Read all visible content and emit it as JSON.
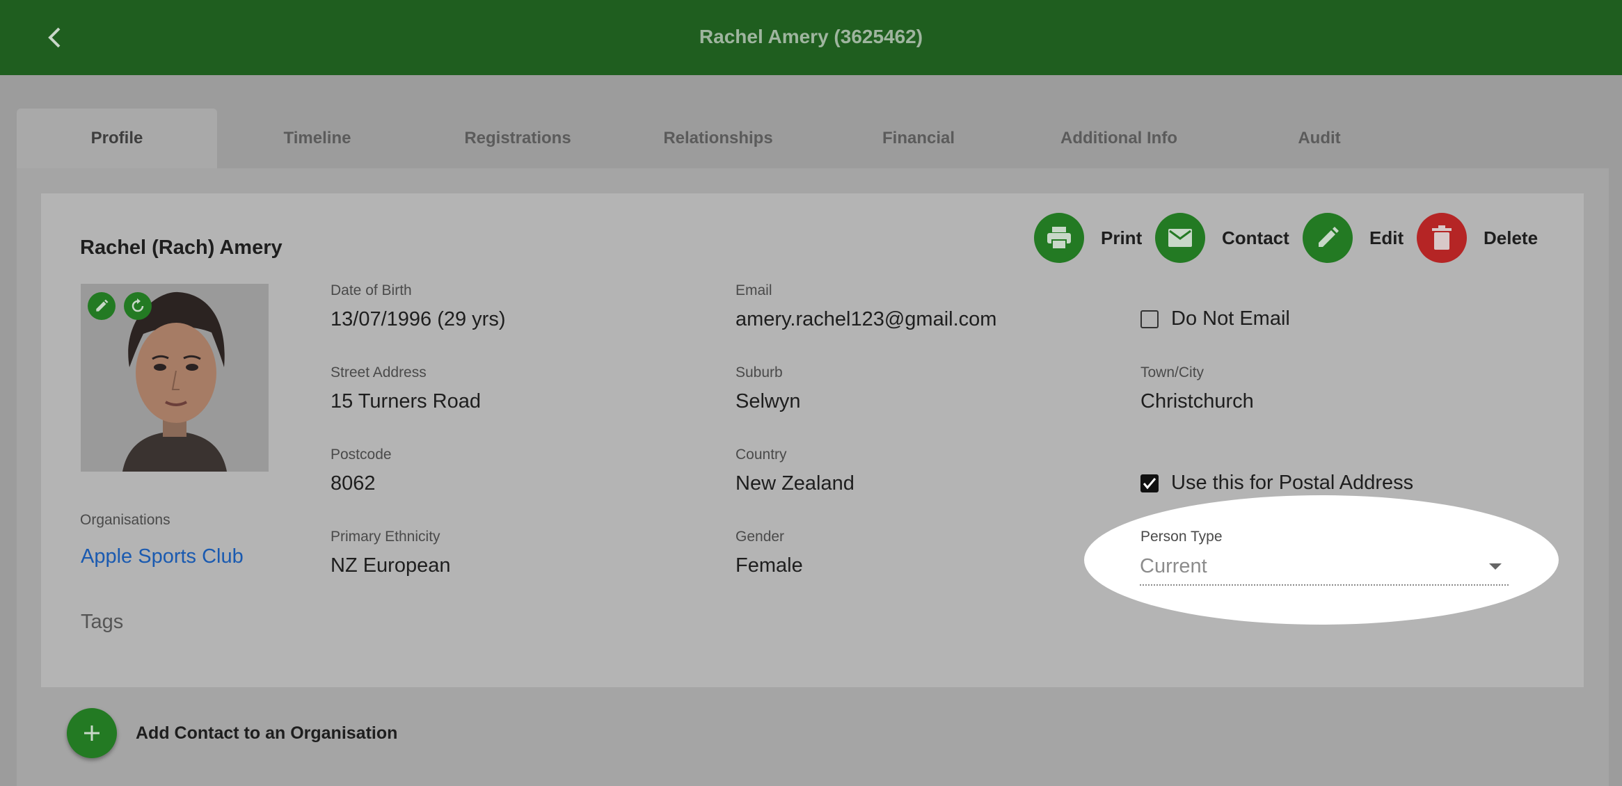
{
  "header": {
    "title": "Rachel Amery (3625462)"
  },
  "tabs": [
    {
      "label": "Profile"
    },
    {
      "label": "Timeline"
    },
    {
      "label": "Registrations"
    },
    {
      "label": "Relationships"
    },
    {
      "label": "Financial"
    },
    {
      "label": "Additional Info"
    },
    {
      "label": "Audit"
    }
  ],
  "profile": {
    "name": "Rachel (Rach) Amery",
    "actions": {
      "print": "Print",
      "contact": "Contact",
      "edit": "Edit",
      "delete": "Delete"
    },
    "fields": {
      "dob": {
        "label": "Date of Birth",
        "value": "13/07/1996 (29 yrs)"
      },
      "email": {
        "label": "Email",
        "value": "amery.rachel123@gmail.com"
      },
      "street": {
        "label": "Street Address",
        "value": "15 Turners Road"
      },
      "suburb": {
        "label": "Suburb",
        "value": "Selwyn"
      },
      "town": {
        "label": "Town/City",
        "value": "Christchurch"
      },
      "postcode": {
        "label": "Postcode",
        "value": "8062"
      },
      "country": {
        "label": "Country",
        "value": "New Zealand"
      },
      "ethnicity": {
        "label": "Primary Ethnicity",
        "value": "NZ European"
      },
      "gender": {
        "label": "Gender",
        "value": "Female"
      }
    },
    "do_not_email": {
      "label": "Do Not Email",
      "checked": false
    },
    "postal": {
      "label": "Use this for Postal Address",
      "checked": true
    },
    "person_type": {
      "label": "Person Type",
      "value": "Current"
    },
    "organisations": {
      "label": "Organisations",
      "items": [
        "Apple Sports Club"
      ]
    },
    "tags": {
      "label": "Tags"
    }
  },
  "add_contact": {
    "label": "Add Contact to an Organisation"
  },
  "colors": {
    "header": "#1f5e1f",
    "action_green": "#237a23",
    "action_red": "#b52525",
    "link": "#1a5ab0"
  }
}
